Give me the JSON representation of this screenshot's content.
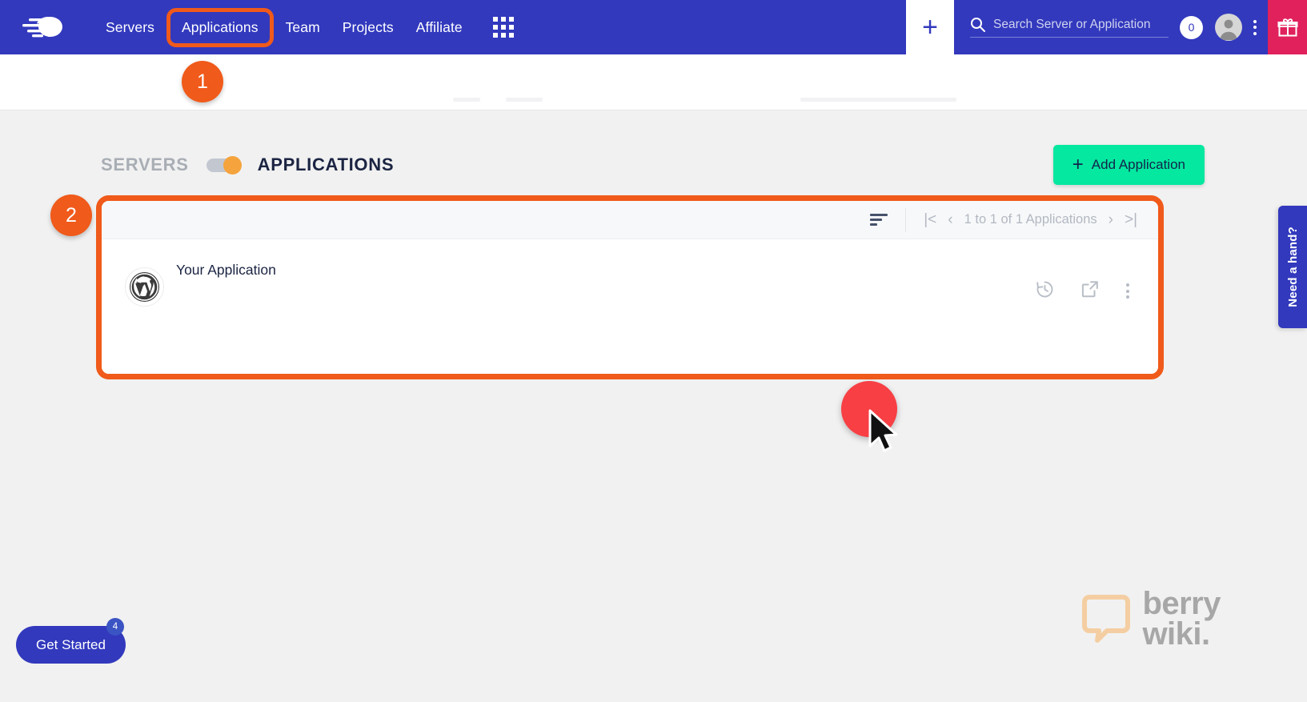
{
  "navbar": {
    "logo_name": "cloudways-logo",
    "links": [
      {
        "label": "Servers",
        "active": false
      },
      {
        "label": "Applications",
        "active": true
      },
      {
        "label": "Team",
        "active": false
      },
      {
        "label": "Projects",
        "active": false
      },
      {
        "label": "Affiliate",
        "active": false
      }
    ],
    "grid_icon": "apps-grid-icon",
    "add_button_label": "+",
    "search": {
      "placeholder": "Search Server or Application",
      "value": ""
    },
    "notification_count": "0",
    "avatar_name": "user-avatar",
    "kebab_name": "more-options-icon",
    "gift_icon": "gift-icon",
    "colors": {
      "brand_blue": "#3239bd",
      "gift_pink": "#e0215c"
    }
  },
  "toolbar": {
    "segment_off_label": "SERVERS",
    "segment_on_label": "APPLICATIONS",
    "toggle_name": "servers-applications-toggle",
    "add_application_label": "Add Application",
    "add_application_plus": "+",
    "accent_green": "#05e8a0",
    "toggle_knob_color": "#f5a33c"
  },
  "card": {
    "sort_icon": "sort-filter-icon",
    "pagination": {
      "first_label": "|<",
      "prev_label": "‹",
      "text": "1 to 1 of 1 Applications",
      "next_label": "›",
      "last_label": ">|"
    },
    "rows": [
      {
        "app_icon": "wordpress-icon",
        "name": "Your Application",
        "actions": [
          {
            "name": "restore-history-icon",
            "label": ""
          },
          {
            "name": "open-external-icon",
            "label": ""
          },
          {
            "name": "row-more-options-icon",
            "label": ""
          }
        ]
      }
    ],
    "highlight_color": "#f05a1a"
  },
  "annotations": {
    "steps": [
      {
        "number": "1",
        "target": "applications-nav-link"
      },
      {
        "number": "2",
        "target": "applications-card"
      }
    ],
    "click_marker": {
      "name": "click-indicator",
      "color": "#f83f44"
    },
    "cursor": {
      "name": "mouse-cursor"
    }
  },
  "widgets": {
    "need_a_hand_label": "Need a hand?",
    "get_started_label": "Get Started",
    "get_started_badge": "4",
    "watermark_line1": "berry",
    "watermark_line2": "wiki."
  }
}
